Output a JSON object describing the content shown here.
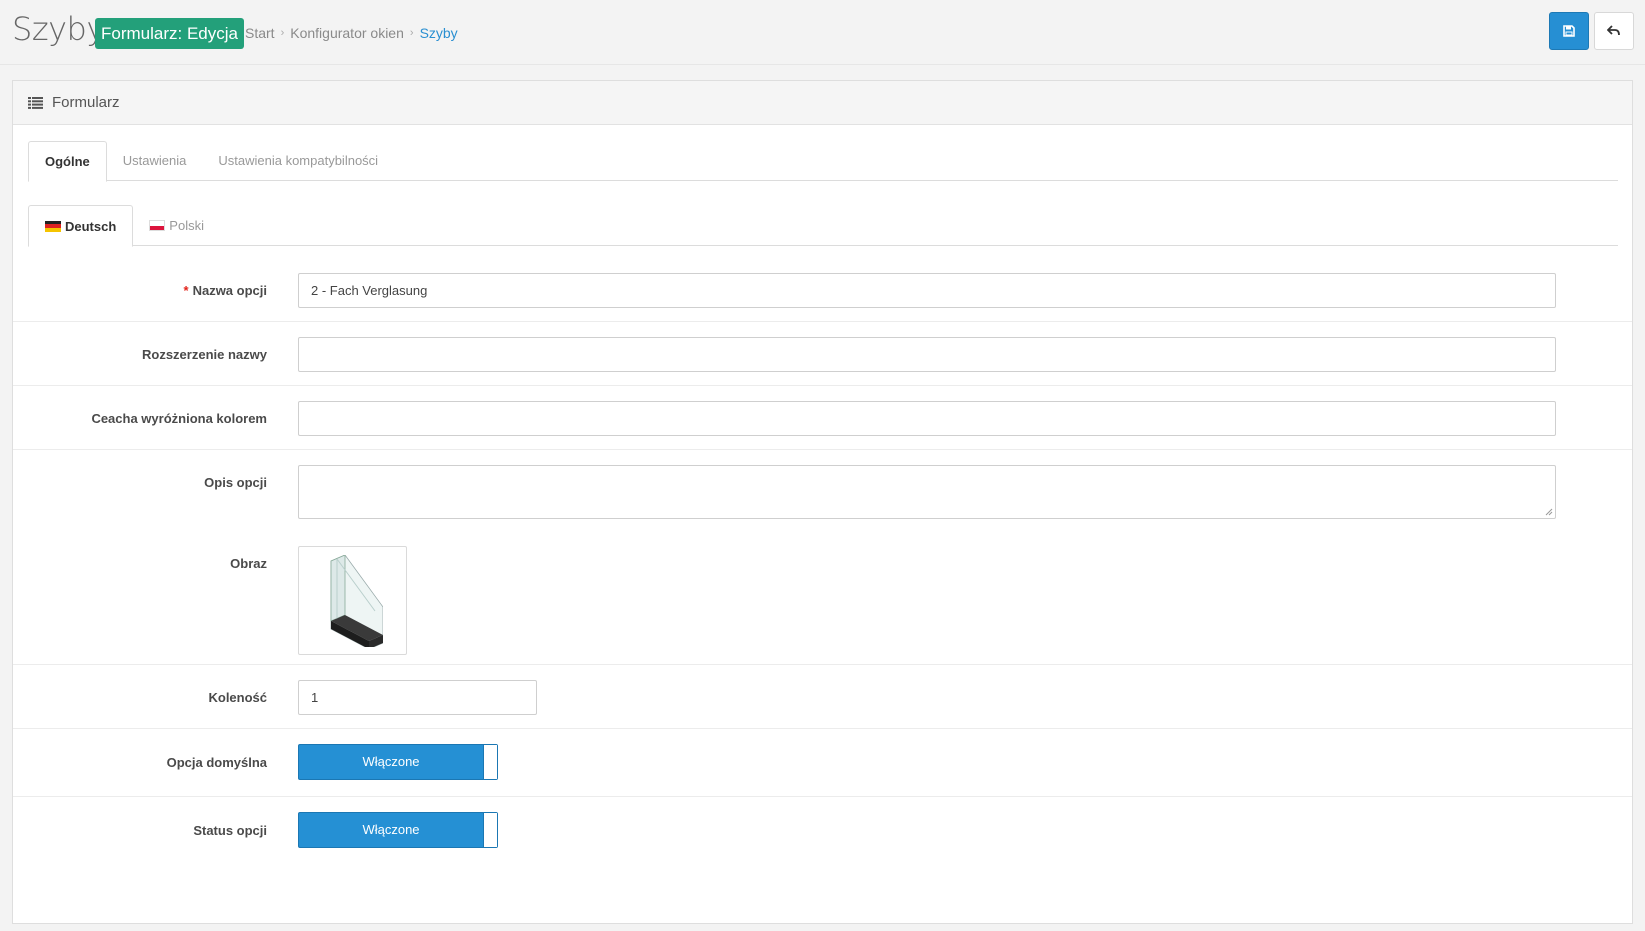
{
  "header": {
    "title": "Szyby",
    "mode_badge": "Formularz: Edycja",
    "breadcrumb": [
      "Start",
      "Konfigurator okien",
      "Szyby"
    ],
    "save_icon": "save-icon",
    "back_icon": "undo-icon"
  },
  "panel": {
    "heading": "Formularz",
    "heading_icon": "list-icon",
    "tabs": [
      {
        "label": "Ogólne",
        "active": true
      },
      {
        "label": "Ustawienia",
        "active": false
      },
      {
        "label": "Ustawienia kompatybilności",
        "active": false
      }
    ],
    "lang_tabs": [
      {
        "label": "Deutsch",
        "flag": "de-flag-icon",
        "active": true
      },
      {
        "label": "Polski",
        "flag": "pl-flag-icon",
        "active": false
      }
    ]
  },
  "form": {
    "option_name": {
      "label": "Nazwa opcji",
      "required_mark": "*",
      "value": "2 - Fach Verglasung"
    },
    "name_extension": {
      "label": "Rozszerzenie nazwy",
      "value": ""
    },
    "color_feature": {
      "label": "Ceacha wyróżniona kolorem",
      "value": ""
    },
    "option_description": {
      "label": "Opis opcji",
      "value": ""
    },
    "image": {
      "label": "Obraz",
      "icon": "double-glazing-icon"
    },
    "order": {
      "label": "Koleność",
      "value": "1"
    },
    "default_option": {
      "label": "Opcja domyślna",
      "state": "Włączone"
    },
    "option_status": {
      "label": "Status opcji",
      "state": "Włączone"
    }
  },
  "colors": {
    "accent": "#268fd3",
    "badge": "#23a07a",
    "required": "#e2231a"
  }
}
